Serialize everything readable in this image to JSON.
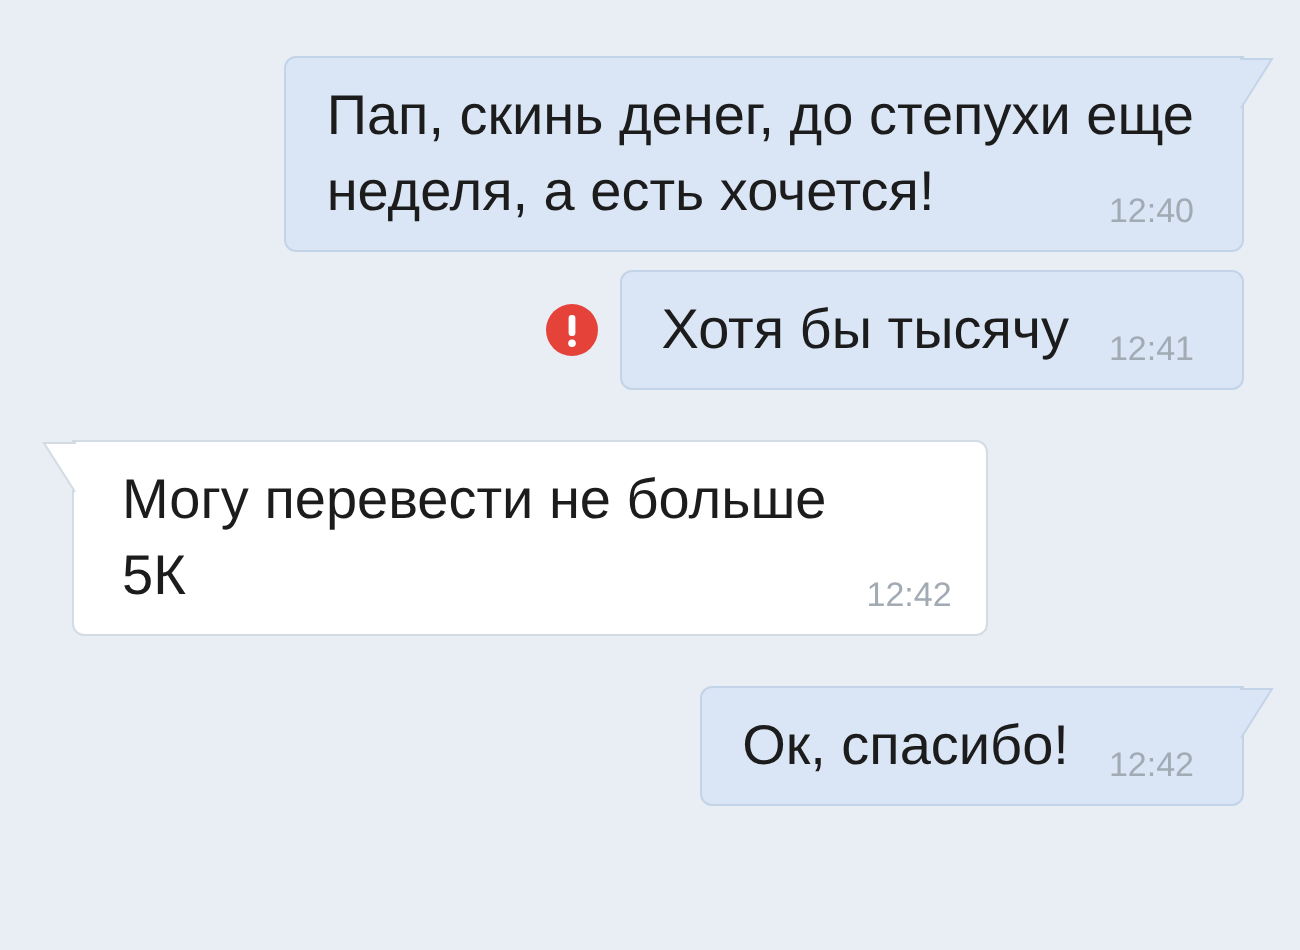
{
  "messages": [
    {
      "kind": "outgoing",
      "text": "Пап, скинь денег, до степухи еще\nнеделя, а есть хочется!",
      "time": "12:40",
      "tail": true,
      "failed": false
    },
    {
      "kind": "outgoing",
      "text": "Хотя бы тысячу",
      "time": "12:41",
      "tail": false,
      "failed": true
    },
    {
      "kind": "incoming",
      "text": "Могу перевести не больше\n5К",
      "time": "12:42",
      "tail": true,
      "failed": false
    },
    {
      "kind": "outgoing",
      "text": "Ок, спасибо!",
      "time": "12:42",
      "tail": true,
      "failed": false
    }
  ]
}
